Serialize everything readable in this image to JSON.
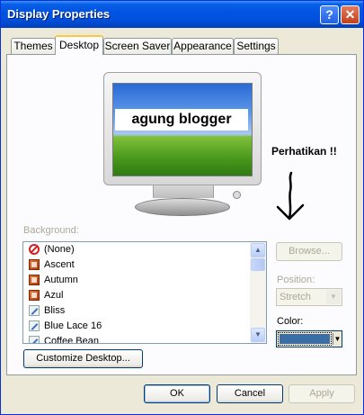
{
  "window": {
    "title": "Display Properties",
    "help_glyph": "?",
    "close_glyph": "✕"
  },
  "tabs": [
    {
      "label": "Themes"
    },
    {
      "label": "Desktop"
    },
    {
      "label": "Screen Saver"
    },
    {
      "label": "Appearance"
    },
    {
      "label": "Settings"
    }
  ],
  "preview": {
    "overlay_text": "agung blogger"
  },
  "annotation": {
    "text": "Perhatikan !!"
  },
  "background": {
    "label": "Background:",
    "items": [
      {
        "label": "(None)",
        "icon": "none-icon"
      },
      {
        "label": "Ascent",
        "icon": "bitmap-icon"
      },
      {
        "label": "Autumn",
        "icon": "bitmap-icon"
      },
      {
        "label": "Azul",
        "icon": "bitmap-icon"
      },
      {
        "label": "Bliss",
        "icon": "jpeg-icon"
      },
      {
        "label": "Blue Lace 16",
        "icon": "jpeg-icon"
      },
      {
        "label": "Coffee Bean",
        "icon": "jpeg-icon"
      }
    ]
  },
  "browse": {
    "label": "Browse..."
  },
  "position": {
    "label": "Position:",
    "value": "Stretch"
  },
  "color": {
    "label": "Color:",
    "value": "#3a6ea5"
  },
  "customize": {
    "label": "Customize Desktop..."
  },
  "dialog_buttons": {
    "ok": "OK",
    "cancel": "Cancel",
    "apply": "Apply"
  }
}
